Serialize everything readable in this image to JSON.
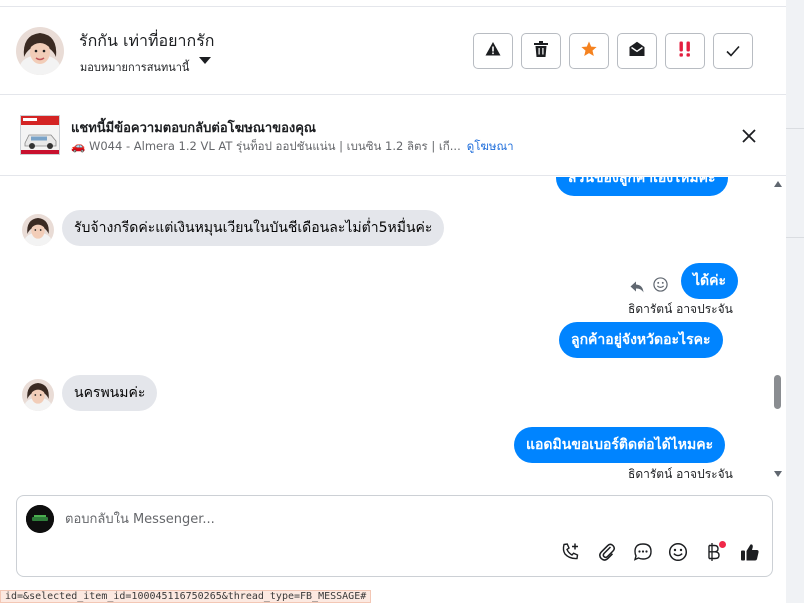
{
  "header": {
    "contact_name": "รักกัน เท่าที่อยากรัก",
    "assign_label": "มอบหมายการสนทนานี้",
    "actions": [
      {
        "icon": "warning-icon",
        "color": "#1c1e21"
      },
      {
        "icon": "trash-icon",
        "color": "#1c1e21"
      },
      {
        "icon": "star-icon",
        "color": "#f5821f"
      },
      {
        "icon": "envelope-open-icon",
        "color": "#1c1e21"
      },
      {
        "icon": "double-exclamation-icon",
        "color": "#e41e3f"
      },
      {
        "icon": "check-icon",
        "color": "#1c1e21"
      }
    ]
  },
  "ad": {
    "title": "แชทนี้มีข้อความตอบกลับต่อโฆษณาของคุณ",
    "description": "🚗 W044 - Almera 1.2 VL AT รุ่นท็อป ออปชันแน่น | เบนซิน 1.2 ลิตร | เกี...",
    "link_label": "ดูโฆษณา"
  },
  "messages": {
    "clipped_outgoing": "ส่วนของลูกค้าเองไหมคะ",
    "m1": "รับจ้างกรีดค่ะแต่เงินหมุนเวียนในบันชีเดือนละไม่ต่ำ5หมื่นค่ะ",
    "m2": "ได้ค่ะ",
    "m2_sender": "ธิดารัตน์ อาจประจัน",
    "m3": "ลูกค้าอยู่จังหวัดอะไรคะ",
    "m4": "นครพนมค่ะ",
    "m5": "แอดมินขอเบอร์ติดต่อได้ไหมคะ",
    "m5_sender": "ธิดารัตน์ อาจประจัน"
  },
  "composer": {
    "placeholder": "ตอบกลับใน Messenger...",
    "tools": [
      "phone-plus-icon",
      "paperclip-icon",
      "chat-bubble-icon",
      "smiley-icon",
      "baht-icon",
      "thumbs-up-icon"
    ]
  },
  "status_bar": {
    "url": "id=&selected_item_id=100045116750265&thread_type=FB_MESSAGE#"
  },
  "colors": {
    "outgoing_bubble": "#0084ff",
    "incoming_bubble": "#e4e6eb",
    "link": "#216fdb"
  }
}
